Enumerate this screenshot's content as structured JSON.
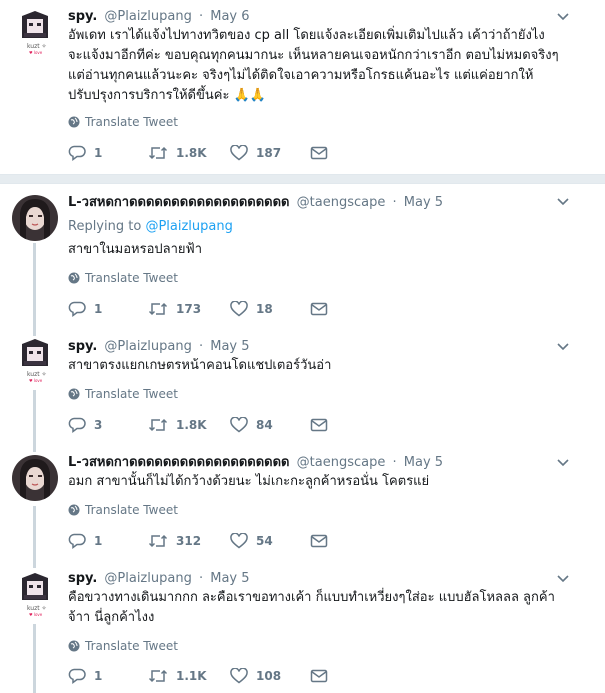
{
  "translate_label": "Translate Tweet",
  "tweets": [
    {
      "name": "spy.",
      "handle": "@Plaizlupang",
      "time": "May 6",
      "text": "อัพเดท เราได้แจ้งไปทางทวิตของ cp all โดยแจ้งละเอียดเพิ่มเติมไปแล้ว เค้าว่าถ้ายังไงจะแจ้งมาอีกทีค่ะ ขอบคุณทุกคนมากนะ เห็นหลายคนเจอหนักกว่าเราอีก ตอบไม่หมดจริงๆแต่อ่านทุกคนแล้วนะคะ จริงๆไม่ได้ติดใจเอาความหรือโกรธแค้นอะไร แต่แค่อยากให้ปรับปรุงการบริการให้ดีขึ้นค่ะ 🙏🙏",
      "replies": "1",
      "retweets": "1.8K",
      "likes": "187"
    },
    {
      "name": "L-วสหดกาดดดดดดดดดดดดดดดดดดด",
      "handle": "@taengscape",
      "time": "May 5",
      "replying_prefix": "Replying to",
      "replying_to": "@Plaizlupang",
      "text": "สาขาในมอหรอปลายฟ้า",
      "replies": "1",
      "retweets": "173",
      "likes": "18"
    },
    {
      "name": "spy.",
      "handle": "@Plaizlupang",
      "time": "May 5",
      "text": "สาขาตรงแยกเกษตรหน้าคอนโดแชปเตอร์วันอ่า",
      "replies": "3",
      "retweets": "1.8K",
      "likes": "84"
    },
    {
      "name": "L-วสหดกาดดดดดดดดดดดดดดดดดดด",
      "handle": "@taengscape",
      "time": "May 5",
      "text": "อมก สาขานั้นก็ไม่ได้กว้างด้วยนะ ไม่เกะกะลูกค้าหรอนั่น โคตรแย่",
      "replies": "1",
      "retweets": "312",
      "likes": "54"
    },
    {
      "name": "spy.",
      "handle": "@Plaizlupang",
      "time": "May 5",
      "text": "คือขวางทางเดินมากกก ละคือเราขอทางเค้า ก็แบบทำเหวี่ยงๆใส่อะ แบบฮัลโหลลล ลูกค้าจ้าา นี่ลูกค้าไงง",
      "replies": "1",
      "retweets": "1.1K",
      "likes": "108"
    }
  ]
}
